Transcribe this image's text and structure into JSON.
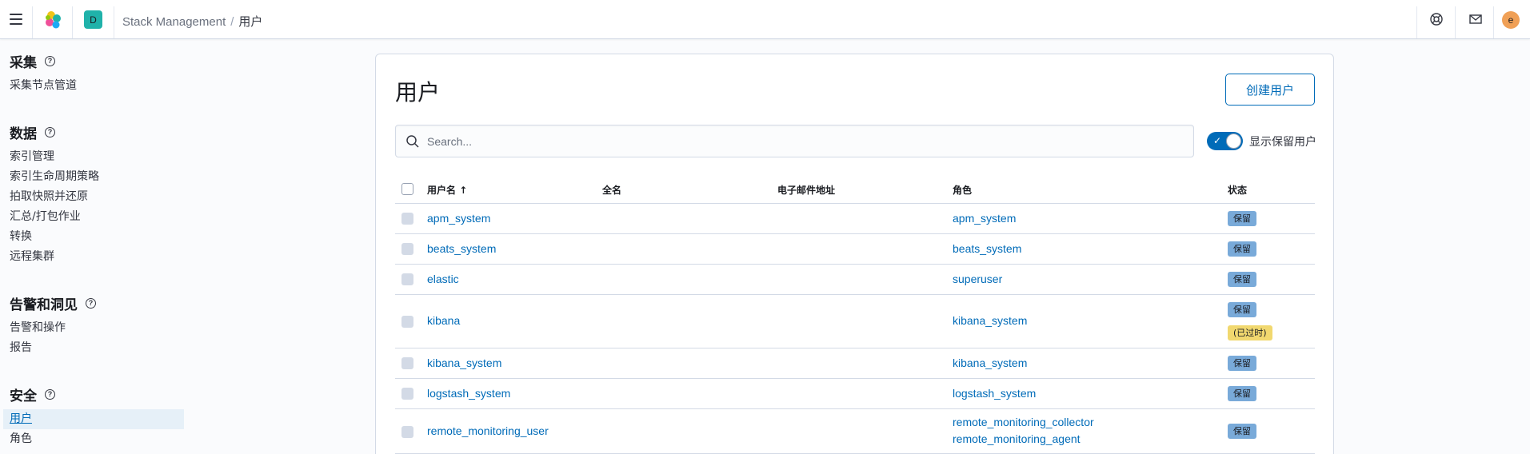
{
  "header": {
    "space_initial": "D",
    "breadcrumbs": [
      "Stack Management",
      "用户"
    ],
    "user_initial": "e",
    "icons": [
      "help-icon",
      "newsfeed-mail-icon"
    ]
  },
  "sidebar": {
    "sections": [
      {
        "title": "采集",
        "items": [
          "采集节点管道"
        ]
      },
      {
        "title": "数据",
        "items": [
          "索引管理",
          "索引生命周期策略",
          "拍取快照并还原",
          "汇总/打包作业",
          "转换",
          "远程集群"
        ]
      },
      {
        "title": "告警和洞见",
        "items": [
          "告警和操作",
          "报告"
        ]
      },
      {
        "title": "安全",
        "items": [
          "用户",
          "角色"
        ]
      }
    ]
  },
  "main": {
    "title": "用户",
    "create_button": "创建用户",
    "search_placeholder": "Search...",
    "toggle_label": "显示保留用户",
    "toggle_on": true,
    "columns": [
      "用户名",
      "全名",
      "电子邮件地址",
      "角色",
      "状态"
    ],
    "sort_indicator": "↑",
    "rows": [
      {
        "username": "apm_system",
        "full_name": "",
        "email": "",
        "roles": [
          "apm_system"
        ],
        "badges": [
          "保留"
        ]
      },
      {
        "username": "beats_system",
        "full_name": "",
        "email": "",
        "roles": [
          "beats_system"
        ],
        "badges": [
          "保留"
        ]
      },
      {
        "username": "elastic",
        "full_name": "",
        "email": "",
        "roles": [
          "superuser"
        ],
        "badges": [
          "保留"
        ]
      },
      {
        "username": "kibana",
        "full_name": "",
        "email": "",
        "roles": [
          "kibana_system"
        ],
        "badges": [
          "保留",
          "(已过时)"
        ]
      },
      {
        "username": "kibana_system",
        "full_name": "",
        "email": "",
        "roles": [
          "kibana_system"
        ],
        "badges": [
          "保留"
        ]
      },
      {
        "username": "logstash_system",
        "full_name": "",
        "email": "",
        "roles": [
          "logstash_system"
        ],
        "badges": [
          "保留"
        ]
      },
      {
        "username": "remote_monitoring_user",
        "full_name": "",
        "email": "",
        "roles": [
          "remote_monitoring_collector",
          "remote_monitoring_agent"
        ],
        "badges": [
          "保留"
        ]
      }
    ]
  },
  "colors": {
    "link": "#006bb8",
    "reserved_badge": "#79aad9",
    "deprecated_badge": "#f1d86f",
    "space_avatar": "#20b2aa",
    "user_avatar": "#f0a056"
  }
}
